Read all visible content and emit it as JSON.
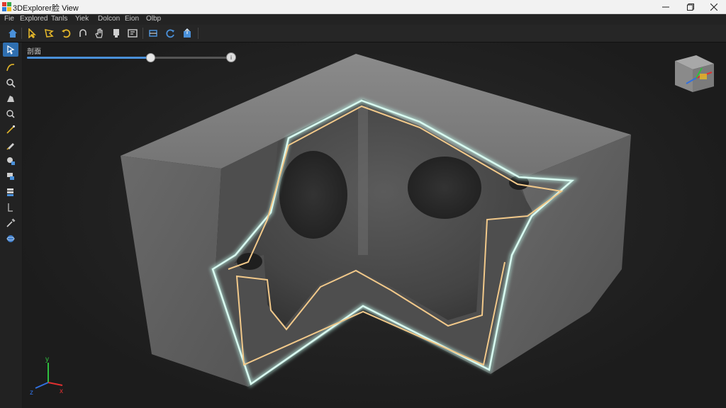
{
  "window": {
    "title": "3DExplorer脸 View",
    "icons": {
      "app": "app-logo-icon",
      "minimize": "minimize-icon",
      "maximize": "maximize-icon",
      "close": "close-icon"
    }
  },
  "menu": {
    "items": [
      {
        "label": "Fie"
      },
      {
        "label": "Explored"
      },
      {
        "label": "Tanls"
      },
      {
        "label": "Yiek"
      },
      {
        "label": "Dolcon"
      },
      {
        "label": "Eion"
      },
      {
        "label": "Olbp"
      }
    ]
  },
  "toolbar": {
    "buttons": [
      {
        "icon": "home-icon",
        "color": "#4a90d9"
      },
      {
        "icon": "select-cursor-icon",
        "color": "#e2b52a"
      },
      {
        "icon": "lasso-select-icon",
        "color": "#e2b52a"
      },
      {
        "icon": "rotate-icon",
        "color": "#e2b52a"
      },
      {
        "icon": "undo-icon",
        "color": "#cfcfcf"
      },
      {
        "icon": "pan-hand-icon",
        "color": "#cfcfcf"
      },
      {
        "icon": "zoom-icon",
        "color": "#cfcfcf"
      },
      {
        "icon": "fit-view-icon",
        "color": "#cfcfcf"
      },
      {
        "icon": "section-plane-icon",
        "color": "#4a90d9"
      },
      {
        "icon": "refresh-view-icon",
        "color": "#4a90d9"
      },
      {
        "icon": "export-icon",
        "color": "#4a90d9"
      }
    ]
  },
  "left_tools": [
    {
      "icon": "pointer-tool-icon",
      "active": true
    },
    {
      "icon": "curve-tool-icon",
      "active": false
    },
    {
      "icon": "magnify-tool-icon",
      "active": false
    },
    {
      "icon": "paint-tool-icon",
      "active": false
    },
    {
      "icon": "search-tool-icon",
      "active": false
    },
    {
      "icon": "wand-tool-icon",
      "active": false
    },
    {
      "icon": "brush-tool-icon",
      "active": false
    },
    {
      "icon": "color-pick-icon",
      "active": false
    },
    {
      "icon": "layers-tool-icon",
      "active": false
    },
    {
      "icon": "stack-tool-icon",
      "active": false
    },
    {
      "icon": "measure-tool-icon",
      "active": false
    },
    {
      "icon": "probe-tool-icon",
      "active": false
    },
    {
      "icon": "sphere-tool-icon",
      "active": false
    }
  ],
  "section_slider": {
    "label": "剖面",
    "value": 0.6
  },
  "colors": {
    "accent": "#4a90d9",
    "section_edge": "#f2c98a",
    "section_glow": "#bff5e8",
    "model_surface": "#7a7a7a",
    "axis_x": "#e03030",
    "axis_y": "#2fbf3f",
    "axis_z": "#3070e0"
  },
  "axis_triad": {
    "x": "x",
    "y": "y",
    "z": "z"
  }
}
